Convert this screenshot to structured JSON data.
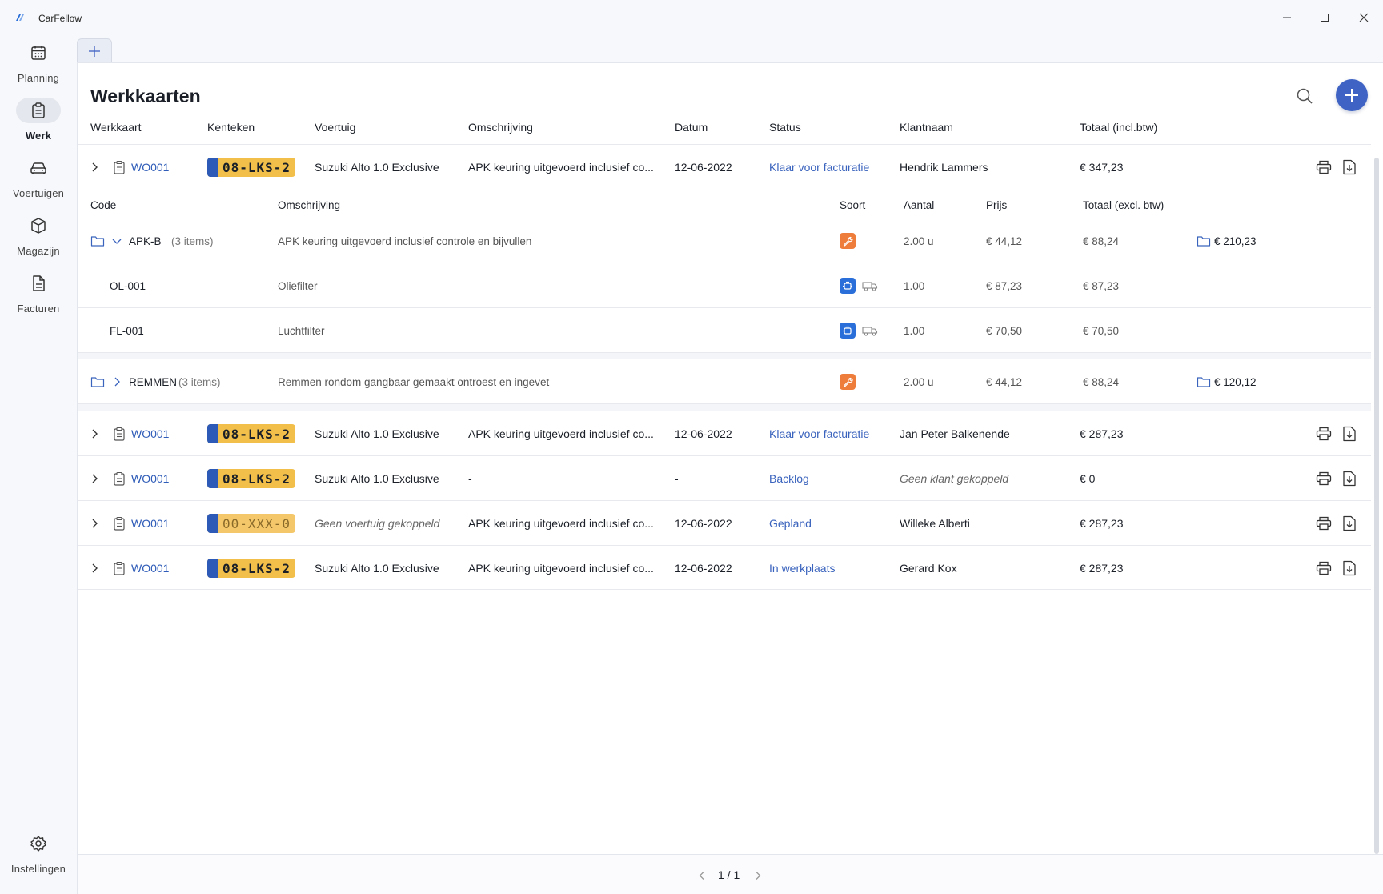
{
  "app": {
    "title": "CarFellow"
  },
  "sidebar": {
    "items": [
      {
        "label": "Planning",
        "icon": "calendar-icon"
      },
      {
        "label": "Werk",
        "icon": "clipboard-icon",
        "active": true
      },
      {
        "label": "Voertuigen",
        "icon": "car-icon"
      },
      {
        "label": "Magazijn",
        "icon": "box-icon"
      },
      {
        "label": "Facturen",
        "icon": "document-icon"
      }
    ],
    "settings_label": "Instellingen"
  },
  "page": {
    "title": "Werkkaarten"
  },
  "table": {
    "headers": [
      "Werkkaart",
      "Kenteken",
      "Voertuig",
      "Omschrijving",
      "Datum",
      "Status",
      "Klantnaam",
      "Totaal (incl.btw)"
    ],
    "rows": [
      {
        "wo": "WO001",
        "plate": "08-LKS-2",
        "vehicle": "Suzuki Alto 1.0 Exclusive",
        "desc": "APK keuring uitgevoerd inclusief co...",
        "date": "12-06-2022",
        "status": "Klaar voor facturatie",
        "customer": "Hendrik Lammers",
        "total": "€ 347,23"
      },
      {
        "wo": "WO001",
        "plate": "08-LKS-2",
        "vehicle": "Suzuki Alto 1.0 Exclusive",
        "desc": "APK keuring uitgevoerd inclusief co...",
        "date": "12-06-2022",
        "status": "Klaar voor facturatie",
        "customer": "Jan Peter Balkenende",
        "total": "€ 287,23"
      },
      {
        "wo": "WO001",
        "plate": "08-LKS-2",
        "vehicle": "Suzuki Alto 1.0 Exclusive",
        "desc": "-",
        "date": "-",
        "status": "Backlog",
        "customer": "Geen klant gekoppeld",
        "total": "€ 0"
      },
      {
        "wo": "WO001",
        "plate": "00-XXX-0",
        "vehicle": "Geen voertuig gekoppeld",
        "desc": "APK keuring uitgevoerd inclusief co...",
        "date": "12-06-2022",
        "status": "Gepland",
        "customer": "Willeke Alberti",
        "total": "€ 287,23"
      },
      {
        "wo": "WO001",
        "plate": "08-LKS-2",
        "vehicle": "Suzuki Alto 1.0 Exclusive",
        "desc": "APK keuring uitgevoerd inclusief co...",
        "date": "12-06-2022",
        "status": "In werkplaats",
        "customer": "Gerard Kox",
        "total": "€ 287,23"
      }
    ]
  },
  "detail": {
    "headers": [
      "Code",
      "Omschrijving",
      "Soort",
      "Aantal",
      "Prijs",
      "Totaal (excl. btw)"
    ],
    "groups": [
      {
        "code": "APK-B",
        "count": "(3 items)",
        "desc": "APK keuring uitgevoerd inclusief controle  en bijvullen",
        "qty": "2.00 u",
        "price": "€ 44,12",
        "total": "€ 88,24",
        "group_total": "€ 210,23",
        "items": [
          {
            "code": "OL-001",
            "desc": "Oliefilter",
            "qty": "1.00",
            "price": "€ 87,23",
            "total": "€ 87,23"
          },
          {
            "code": "FL-001",
            "desc": "Luchtfilter",
            "qty": "1.00",
            "price": "€ 70,50",
            "total": "€ 70,50"
          }
        ]
      },
      {
        "code": "REMMEN",
        "count": "(3 items)",
        "desc": "Remmen rondom gangbaar gemaakt ontroest en ingevet",
        "qty": "2.00 u",
        "price": "€ 44,12",
        "total": "€ 88,24",
        "group_total": "€ 120,12"
      }
    ]
  },
  "pager": {
    "text": "1 / 1"
  },
  "colors": {
    "accent": "#3e63c4",
    "plate": "#f2c04a",
    "plate_eu": "#2d5ab7",
    "labor": "#ee7c3b",
    "part": "#2a6fd9"
  }
}
